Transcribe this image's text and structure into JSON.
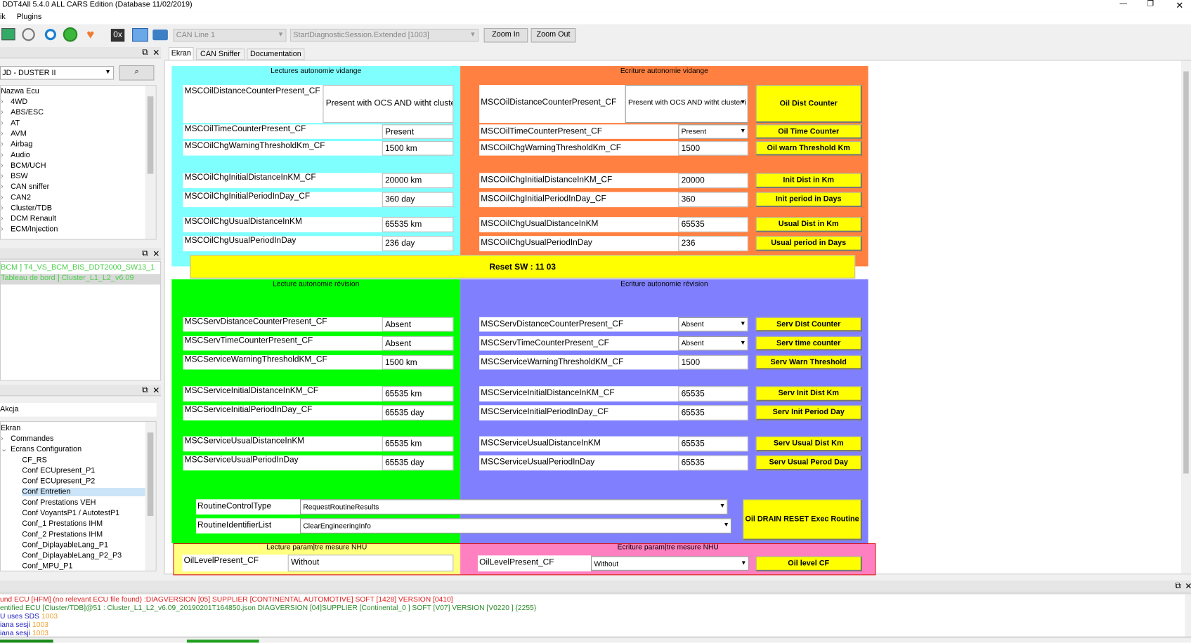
{
  "window": {
    "title": "DDT4All 5.4.0 ALL CARS Edition (Database 11/02/2019)",
    "controls": [
      "—",
      "❐",
      "✕"
    ]
  },
  "menu": [
    "ik",
    "Plugins"
  ],
  "toolbar": {
    "can_line": "CAN Line 1",
    "session": "StartDiagnosticSession.Extended [1003]",
    "zoom_in": "Zoom In",
    "zoom_out": "Zoom Out"
  },
  "left": {
    "vehicle": "JD - DUSTER II",
    "tree_header": "Nazwa Ecu",
    "ecus": [
      "4WD",
      "ABS/ESC",
      "AT",
      "AVM",
      "Airbag",
      "Audio",
      "BCM/UCH",
      "BSW",
      "CAN sniffer",
      "CAN2",
      "Cluster/TDB",
      "DCM Renault",
      "ECM/Injection"
    ],
    "found": [
      "BCM ] T4_VS_BCM_BIS_DDT2000_SW13_1",
      "Tableau de bord ] Cluster_L1_L2_v6.09"
    ],
    "action_label": "Akcja",
    "screens_root": "Ekran",
    "screens": [
      {
        "label": "Commandes",
        "level": 1,
        "exp": "›"
      },
      {
        "label": "Ecrans Configuration",
        "level": 1,
        "exp": "⌄"
      },
      {
        "label": "CF_RS",
        "level": 2
      },
      {
        "label": "Conf ECUpresent_P1",
        "level": 2
      },
      {
        "label": "Conf ECUpresent_P2",
        "level": 2
      },
      {
        "label": "Conf Entretien",
        "level": 2,
        "selected": true
      },
      {
        "label": "Conf Prestations VEH",
        "level": 2
      },
      {
        "label": "Conf VoyantsP1 / AutotestP1",
        "level": 2
      },
      {
        "label": "Conf_1 Prestations IHM",
        "level": 2
      },
      {
        "label": "Conf_2 Prestations IHM",
        "level": 2
      },
      {
        "label": "Conf_DiplayableLang_P1",
        "level": 2
      },
      {
        "label": "Conf_DiplayableLang_P2_P3",
        "level": 2
      },
      {
        "label": "Conf_MPU_P1",
        "level": 2
      }
    ]
  },
  "tabs": [
    "Ekran",
    "CAN Sniffer",
    "Documentation"
  ],
  "screen": {
    "oil_read": {
      "title": "Lectures autonomie vidange",
      "rows": [
        {
          "label": "MSCOilDistanceCounterPresent_CF",
          "value": "Present with OCS AND witht cluste"
        },
        {
          "label": "MSCOilTimeCounterPresent_CF",
          "value": "Present"
        },
        {
          "label": "MSCOilChgWarningThresholdKm_CF",
          "value": "1500 km"
        },
        {
          "label": "MSCOilChgInitialDistanceInKM_CF",
          "value": "20000 km"
        },
        {
          "label": "MSCOilChgInitialPeriodInDay_CF",
          "value": "360 day"
        },
        {
          "label": "MSCOilChgUsualDistanceInKM",
          "value": "65535 km"
        },
        {
          "label": "MSCOilChgUsualPeriodInDay",
          "value": "236 day"
        }
      ]
    },
    "oil_write": {
      "title": "Ecriture autonomie vidange",
      "rows": [
        {
          "label": "MSCOilDistanceCounterPresent_CF",
          "value": "Present with OCS AND witht cluster i",
          "combo": true,
          "button": "Oil Dist Counter"
        },
        {
          "label": "MSCOilTimeCounterPresent_CF",
          "value": "Present",
          "combo": true,
          "button": "Oil Time Counter"
        },
        {
          "label": "MSCOilChgWarningThresholdKm_CF",
          "value": "1500",
          "button": "Oil warn Threshold Km"
        },
        {
          "label": "MSCOilChgInitialDistanceInKM_CF",
          "value": "20000",
          "button": "Init Dist in Km"
        },
        {
          "label": "MSCOilChgInitialPeriodInDay_CF",
          "value": "360",
          "button": "Init period in Days"
        },
        {
          "label": "MSCOilChgUsualDistanceInKM",
          "value": "65535",
          "button": "Usual Dist in Km"
        },
        {
          "label": "MSCOilChgUsualPeriodInDay",
          "value": "236",
          "button": "Usual period in Days"
        }
      ]
    },
    "reset": "Reset SW : 11 03",
    "serv_read": {
      "title": "Lecture autonomie révision",
      "rows": [
        {
          "label": "MSCServDistanceCounterPresent_CF",
          "value": "Absent"
        },
        {
          "label": "MSCServTimeCounterPresent_CF",
          "value": "Absent"
        },
        {
          "label": "MSCServiceWarningThresholdKM_CF",
          "value": "1500 km"
        },
        {
          "label": "MSCServiceInitialDistanceInKM_CF",
          "value": "65535 km"
        },
        {
          "label": "MSCServiceInitialPeriodInDay_CF",
          "value": "65535 day"
        },
        {
          "label": "MSCServiceUsualDistanceInKM",
          "value": "65535 km"
        },
        {
          "label": "MSCServiceUsualPeriodInDay",
          "value": "65535 day"
        }
      ]
    },
    "serv_write": {
      "title": "Ecriture autonomie révision",
      "rows": [
        {
          "label": "MSCServDistanceCounterPresent_CF",
          "value": "Absent",
          "combo": true,
          "button": "Serv Dist Counter"
        },
        {
          "label": "MSCServTimeCounterPresent_CF",
          "value": "Absent",
          "combo": true,
          "button": "Serv time counter"
        },
        {
          "label": "MSCServiceWarningThresholdKM_CF",
          "value": "1500",
          "button": "Serv Warn Threshold"
        },
        {
          "label": "MSCServiceInitialDistanceInKM_CF",
          "value": "65535",
          "button": "Serv Init Dist Km"
        },
        {
          "label": "MSCServiceInitialPeriodInDay_CF",
          "value": "65535",
          "button": "Serv Init Period Day"
        },
        {
          "label": "MSCServiceUsualDistanceInKM",
          "value": "65535",
          "button": "Serv Usual Dist Km"
        },
        {
          "label": "MSCServiceUsualPeriodInDay",
          "value": "65535",
          "button": "Serv Usual Perod Day"
        }
      ]
    },
    "routine": {
      "type_label": "RoutineControlType",
      "type_value": "RequestRoutineResults",
      "id_label": "RoutineIdentifierList",
      "id_value": "ClearEngineeringInfo",
      "button": "Oil DRAIN RESET Exec Routine"
    },
    "nhu_read": {
      "title": "Lecture param|tre mesure NHU",
      "label": "OilLevelPresent_CF",
      "value": "Without"
    },
    "nhu_write": {
      "title": "Ecriture param|tre mesure NHU",
      "label": "OilLevelPresent_CF",
      "value": "Without",
      "button": "Oil level CF"
    }
  },
  "log": [
    {
      "text": "und ECU [HFM] (no relevant ECU file found) :DIAGVERSION [05] SUPPLIER [CONTINENTAL AUTOMOTIVE] SOFT [1428] VERSION [0410]",
      "color": "#e02020"
    },
    {
      "text": "entified ECU [Cluster/TDB]@51 : Cluster_L1_L2_v6.09_20190201T164850.json DIAGVERSION [04]SUPPLIER [Continental_0 ] SOFT [V07] VERSION [V0220 ] {2255}",
      "color": "#2a8a2a"
    },
    {
      "text": "U uses SDS",
      "extra": "1003",
      "color": "#2020c0"
    },
    {
      "text": "iana sesji",
      "extra": "1003",
      "color": "#2020c0"
    },
    {
      "text": "iana sesji",
      "extra": "1003",
      "color": "#2020c0"
    }
  ],
  "colors": {
    "cyan": "#80ffff",
    "orange": "#ff8040",
    "green": "#00ff00",
    "purple": "#8080ff",
    "yellow": "#ffff00",
    "light_yellow": "#ffff80",
    "pink": "#ff80c0"
  }
}
